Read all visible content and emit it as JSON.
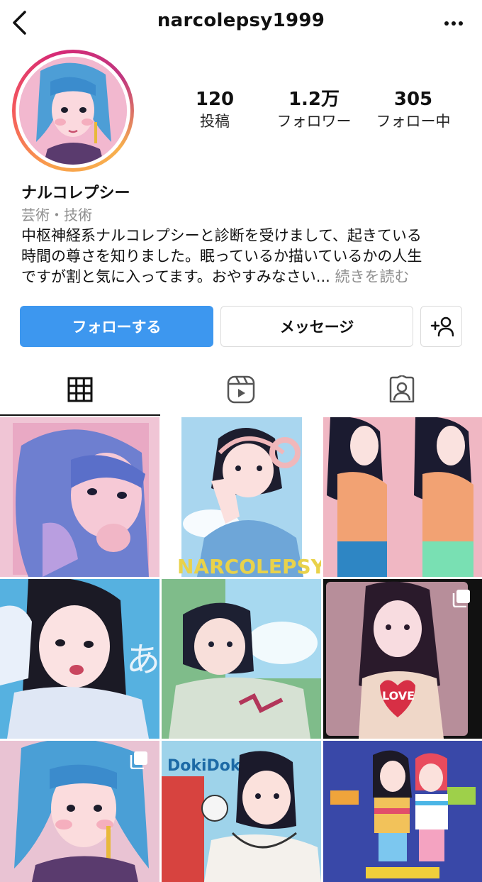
{
  "header": {
    "username": "narcolepsy1999"
  },
  "profile": {
    "display_name": "ナルコレプシー",
    "category": "芸術・技術",
    "bio_line1": "中枢神経系ナルコレプシーと診断を受けまして、起きている",
    "bio_line2": "時間の尊さを知りました。眠っているか描いているかの人生",
    "bio_line3": "ですが割と気に入ってます。おやすみなさい...",
    "bio_more": "続きを読む"
  },
  "stats": {
    "posts": {
      "value": "120",
      "label": "投稿"
    },
    "followers": {
      "value": "1.2万",
      "label": "フォロワー"
    },
    "following": {
      "value": "305",
      "label": "フォロー中"
    }
  },
  "actions": {
    "follow": "フォローする",
    "message": "メッセージ"
  },
  "tabs": [
    {
      "icon": "grid-icon",
      "active": true
    },
    {
      "icon": "reels-icon",
      "active": false
    },
    {
      "icon": "tagged-icon",
      "active": false
    }
  ],
  "posts": [
    {
      "name": "post-1",
      "multi": false
    },
    {
      "name": "post-2",
      "multi": false,
      "text": "NARCOLEPSY"
    },
    {
      "name": "post-3",
      "multi": false
    },
    {
      "name": "post-4",
      "multi": false,
      "text": "あ"
    },
    {
      "name": "post-5",
      "multi": false
    },
    {
      "name": "post-6",
      "multi": true,
      "text": "LOVE"
    },
    {
      "name": "post-7",
      "multi": true
    },
    {
      "name": "post-8",
      "multi": false,
      "text": "DokiDoki"
    },
    {
      "name": "post-9",
      "multi": false
    }
  ],
  "colors": {
    "accent": "#3d97ef",
    "muted": "#8e8e8e",
    "border": "#dbdbdb"
  }
}
